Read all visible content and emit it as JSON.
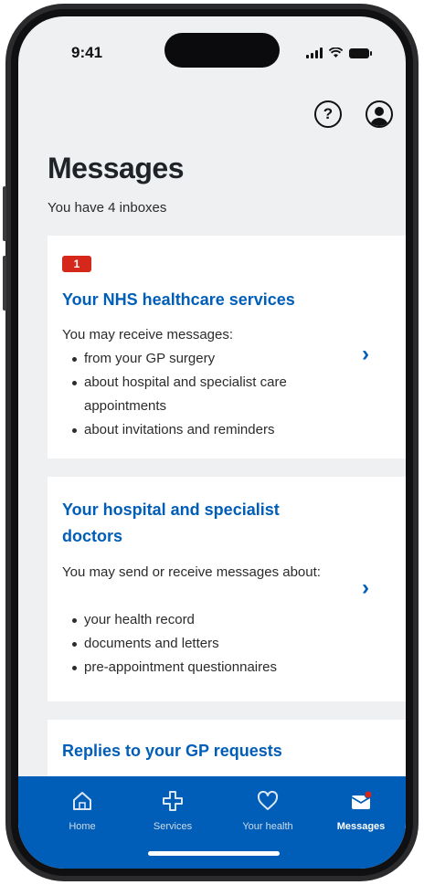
{
  "status_bar": {
    "time": "9:41"
  },
  "page": {
    "title": "Messages",
    "subtitle": "You have 4 inboxes"
  },
  "cards": [
    {
      "badge": "1",
      "title": "Your NHS healthcare services",
      "description": "You may receive messages:",
      "items": [
        "from your GP surgery",
        "about hospital and specialist care appointments",
        "about invitations and reminders"
      ]
    },
    {
      "title_line1": "Your hospital and specialist",
      "title_line2": "doctors",
      "description": "You may send or receive messages about:",
      "items": [
        "your health record",
        "documents and letters",
        "pre-appointment questionnaires"
      ]
    },
    {
      "title": "Replies to your GP requests"
    }
  ],
  "tabs": [
    {
      "label": "Home",
      "icon": "home-icon"
    },
    {
      "label": "Services",
      "icon": "plus-icon"
    },
    {
      "label": "Your health",
      "icon": "heart-icon"
    },
    {
      "label": "Messages",
      "icon": "envelope-icon",
      "active": true
    }
  ],
  "colors": {
    "nhs_blue": "#005eb8",
    "badge_red": "#d5281b",
    "background": "#eef0f2"
  }
}
